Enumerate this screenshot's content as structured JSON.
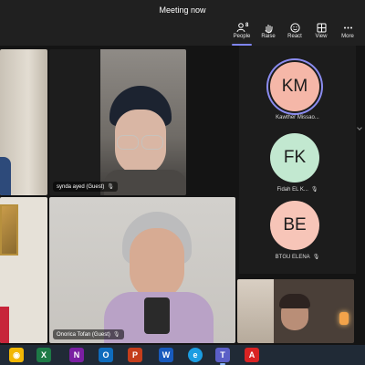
{
  "window": {
    "title": "Meeting now"
  },
  "toolbar": {
    "buttons": [
      {
        "label": "People",
        "icon": "people-icon",
        "count": "8",
        "active": true
      },
      {
        "label": "Raise",
        "icon": "raise-hand-icon"
      },
      {
        "label": "React",
        "icon": "react-smiley-icon"
      },
      {
        "label": "View",
        "icon": "view-grid-icon"
      },
      {
        "label": "More",
        "icon": "more-dots-icon"
      }
    ]
  },
  "participants": {
    "video_tiles": [
      {
        "name": "synda ayed (Guest)"
      },
      {
        "name": "Onorica Tofan (Guest)"
      }
    ],
    "avatars": [
      {
        "initials": "KM",
        "name": "Kawther Missao...",
        "color": "#f5b7a8",
        "speaking": true
      },
      {
        "initials": "FK",
        "name": "Fidah EL K...",
        "color": "#c2e8d0",
        "muted": true
      },
      {
        "initials": "BE",
        "name": "BTGU ELENA",
        "color": "#f7c5b8",
        "muted": true
      }
    ]
  },
  "taskbar": {
    "apps": [
      "chrome-icon",
      "excel-icon",
      "onenote-icon",
      "outlook-icon",
      "powerpoint-icon",
      "word-icon",
      "edge-icon",
      "teams-icon",
      "acrobat-icon"
    ]
  }
}
